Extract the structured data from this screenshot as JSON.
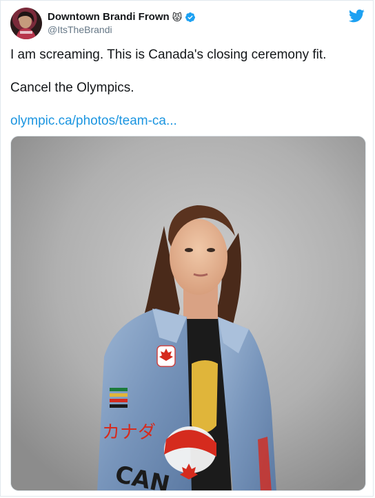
{
  "author": {
    "display_name": "Downtown Brandi Frown",
    "emoji": "😾",
    "handle": "@ItsTheBrandi",
    "verified": true
  },
  "tweet": {
    "line1": "I am screaming. This is Canada's closing ceremony fit.",
    "line2": "Cancel the Olympics.",
    "link_text": "olympic.ca/photos/team-ca..."
  },
  "photo": {
    "jacket_text_vertical": "カナダ",
    "jacket_patch_text": "CAN"
  },
  "colors": {
    "twitter_blue": "#1da1f2",
    "link_blue": "#1b95e0",
    "verified_blue": "#1da1f2",
    "denim": "#7d9bc0",
    "canada_red": "#d52b1e"
  },
  "icons": {
    "logo": "twitter-bird-icon",
    "verified": "verified-badge-icon"
  }
}
